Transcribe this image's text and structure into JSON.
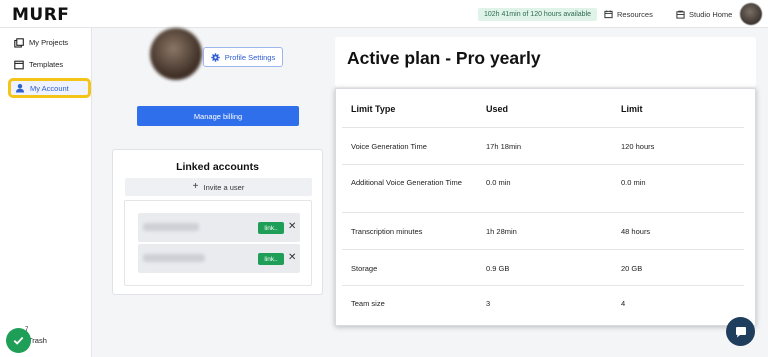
{
  "app": {
    "logo": "MURF"
  },
  "topbar": {
    "hours_available": "102h 41min of 120 hours available",
    "resources_label": "Resources",
    "studio_home_label": "Studio Home"
  },
  "sidebar": {
    "items": [
      {
        "label": "My Projects",
        "icon": "projects-icon"
      },
      {
        "label": "Templates",
        "icon": "templates-icon"
      },
      {
        "label": "My Account",
        "icon": "user-icon",
        "active": true
      }
    ],
    "trash_label": "Trash",
    "badge_count": "7"
  },
  "profile": {
    "settings_label": "Profile Settings",
    "manage_billing_label": "Manage billing"
  },
  "linked_accounts": {
    "title": "Linked accounts",
    "invite_label": "Invite a user",
    "rows": [
      {
        "link_label": "link..",
        "remove_label": "✕"
      },
      {
        "link_label": "link..",
        "remove_label": "✕"
      }
    ]
  },
  "plan": {
    "title": "Active plan - Pro yearly",
    "headers": [
      "Limit Type",
      "Used",
      "Limit"
    ],
    "rows": [
      [
        "Voice Generation Time",
        "17h 18min",
        "120 hours"
      ],
      [
        "Additional Voice Generation Time",
        "0.0 min",
        "0.0 min"
      ],
      [
        "Transcription minutes",
        "1h 28min",
        "48 hours"
      ],
      [
        "Storage",
        "0.9 GB",
        "20 GB"
      ],
      [
        "Team size",
        "3",
        "4"
      ]
    ]
  },
  "colors": {
    "accent": "#2f6fec",
    "success": "#1e9e57",
    "highlight": "#f4c419",
    "chat": "#1f3d5c"
  }
}
